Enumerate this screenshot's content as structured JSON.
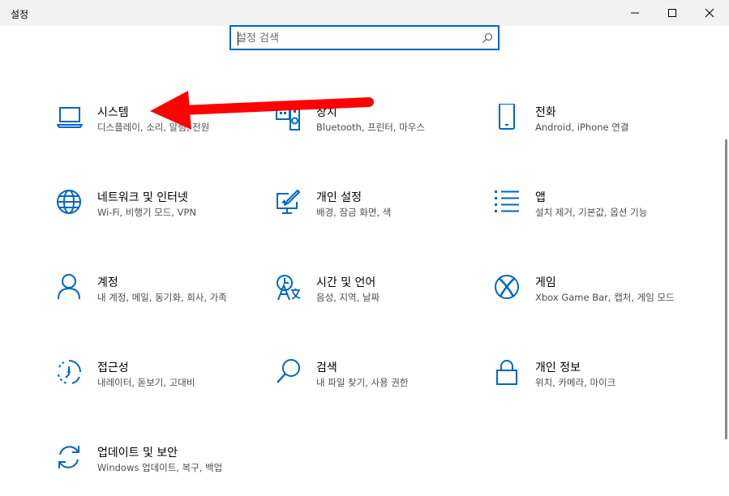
{
  "window": {
    "title": "설정",
    "minimize_icon": "minimize-icon",
    "maximize_icon": "maximize-icon",
    "close_icon": "close-icon"
  },
  "search": {
    "placeholder": "설정 검색",
    "value": "",
    "icon": "search-icon"
  },
  "accent_color": "#0067c0",
  "annotation_color": "#ff0000",
  "categories": [
    {
      "name": "시스템",
      "desc": "디스플레이, 소리, 알림, 전원",
      "icon": "laptop-icon"
    },
    {
      "name": "장치",
      "desc": "Bluetooth, 프린터, 마우스",
      "icon": "devices-icon"
    },
    {
      "name": "전화",
      "desc": "Android, iPhone 연결",
      "icon": "phone-icon"
    },
    {
      "name": "네트워크 및 인터넷",
      "desc": "Wi-Fi, 비행기 모드, VPN",
      "icon": "globe-icon"
    },
    {
      "name": "개인 설정",
      "desc": "배경, 잠금 화면, 색",
      "icon": "personalization-icon"
    },
    {
      "name": "앱",
      "desc": "설치 제거, 기본값, 옵션 기능",
      "icon": "apps-list-icon"
    },
    {
      "name": "계정",
      "desc": "내 계정, 메일, 동기화, 회사, 가족",
      "icon": "person-icon"
    },
    {
      "name": "시간 및 언어",
      "desc": "음성, 지역, 날짜",
      "icon": "time-language-icon"
    },
    {
      "name": "게임",
      "desc": "Xbox Game Bar, 캡처, 게임 모드",
      "icon": "xbox-icon"
    },
    {
      "name": "접근성",
      "desc": "내레이터, 돋보기, 고대비",
      "icon": "accessibility-icon"
    },
    {
      "name": "검색",
      "desc": "내 파일 찾기, 사용 권한",
      "icon": "magnifier-icon"
    },
    {
      "name": "개인 정보",
      "desc": "위치, 카메라, 마이크",
      "icon": "lock-icon"
    },
    {
      "name": "업데이트 및 보안",
      "desc": "Windows 업데이트, 복구, 백업",
      "icon": "sync-icon"
    }
  ]
}
